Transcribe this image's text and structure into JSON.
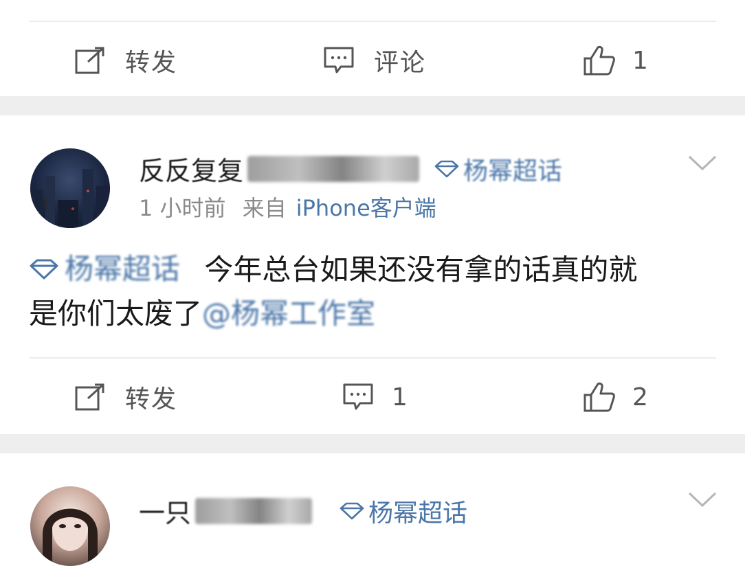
{
  "post0": {
    "actions": {
      "repost_label": "转发",
      "comment_label": "评论",
      "like_count": "1"
    }
  },
  "post1": {
    "username": "反反复复",
    "super_topic_tag": "杨幂超话",
    "meta_time": "1 小时前",
    "meta_from": "来自",
    "meta_source": "iPhone客户端",
    "topic_link": "杨幂超话",
    "text_line1": "今年总台如果还没有拿的话真的就",
    "text_line2": "是你们太废了",
    "mention": "@杨幂工作室",
    "actions": {
      "repost_label": "转发",
      "comment_count": "1",
      "like_count": "2"
    }
  },
  "post2": {
    "username": "一只",
    "super_topic_tag": "杨幂超话"
  },
  "colors": {
    "link": "#4a76a8",
    "divider_band": "#eeeeee",
    "meta_gray": "#8a8a8a"
  }
}
